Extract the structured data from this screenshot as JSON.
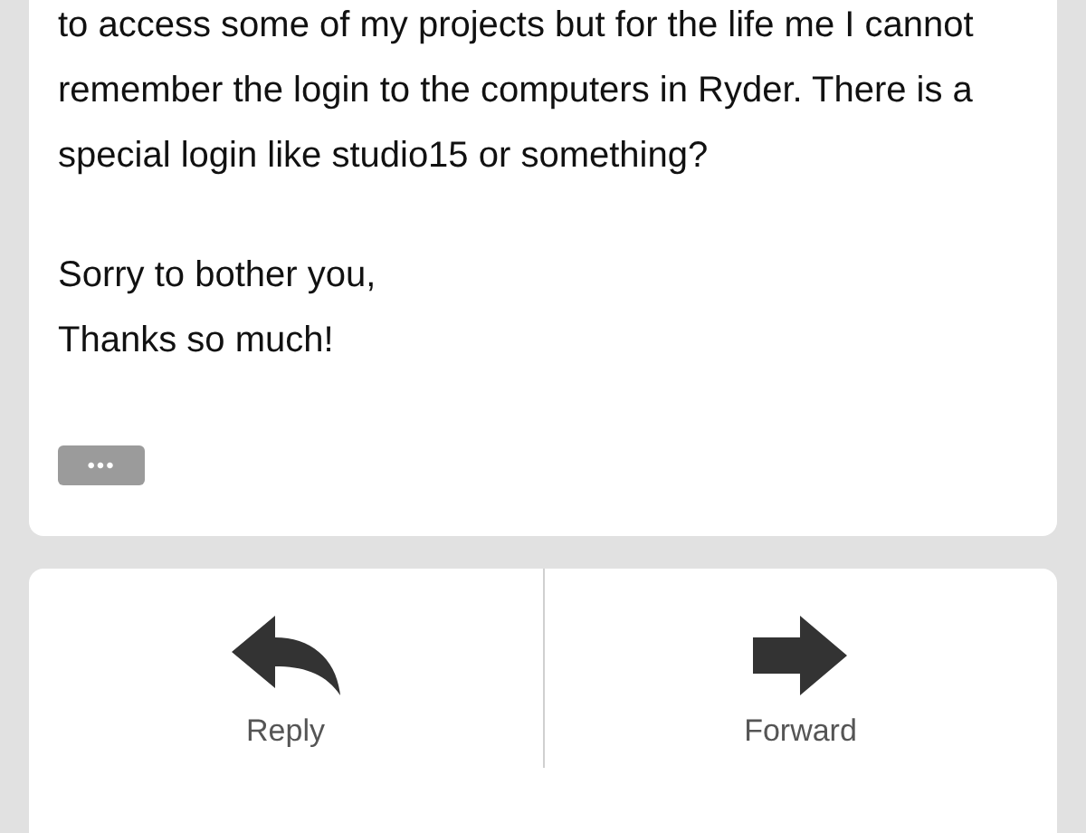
{
  "message": {
    "paragraphs": [
      "to access some of my projects but for the life me I cannot remember the login to the computers in Ryder. There is a special login like studio15 or something?",
      "Sorry to bother you,\nThanks so much!"
    ],
    "more_button": "•••"
  },
  "actions": [
    {
      "kind": "reply",
      "label": "Reply"
    },
    {
      "kind": "forward",
      "label": "Forward"
    }
  ]
}
